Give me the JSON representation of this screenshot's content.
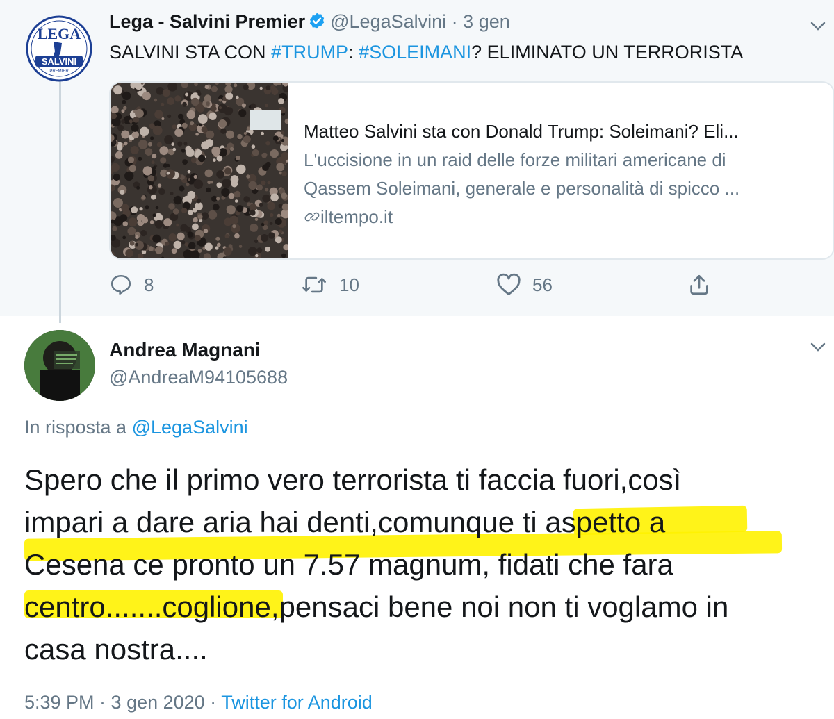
{
  "original_tweet": {
    "author_name": "Lega - Salvini Premier",
    "handle": "@LegaSalvini",
    "separator": "·",
    "date": "3 gen",
    "avatar_logo_text": [
      "LEGA",
      "SALVINI",
      "PREMIER"
    ],
    "text_parts": [
      {
        "text": "SALVINI STA CON ",
        "hashtag": false
      },
      {
        "text": "#TRUMP",
        "hashtag": true
      },
      {
        "text": ":  ",
        "hashtag": false
      },
      {
        "text": "#SOLEIMANI",
        "hashtag": true
      },
      {
        "text": "? ELIMINATO UN TERRORISTA",
        "hashtag": false
      }
    ],
    "card": {
      "title": "Matteo Salvini sta con Donald Trump: Soleimani? Eli...",
      "description_line1": "L'uccisione in un raid delle forze militari americane di",
      "description_line2": "Qassem Soleimani, generale e personalità di spicco ...",
      "domain": "iltempo.it"
    },
    "actions": {
      "replies": "8",
      "retweets": "10",
      "likes": "56"
    }
  },
  "reply_tweet": {
    "author_name": "Andrea Magnani",
    "handle": "@AndreaM94105688",
    "reply_prefix": "In risposta a",
    "reply_mention": "@LegaSalvini",
    "text_lines": [
      "Spero che il primo vero terrorista ti faccia fuori,così",
      "impari a dare aria hai denti,comunque ti aspetto a",
      "Cesena ce pronto un 7.57 magnum, fidati che fara",
      "centro.......coglione,pensaci bene noi non ti voglamo in",
      "casa nostra...."
    ],
    "timestamp": "5:39 PM · 3 gen 2020 ·",
    "source": "Twitter for Android"
  },
  "colors": {
    "link_blue": "#1b95e0",
    "verified_blue": "#1da1f2",
    "muted_gray": "#657786",
    "highlight_yellow": "#fff200"
  }
}
